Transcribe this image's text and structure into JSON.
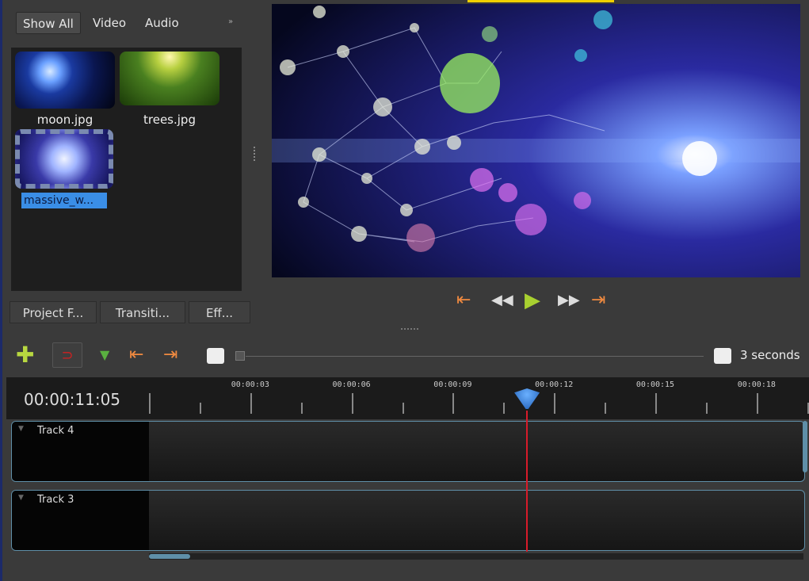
{
  "filter_tabs": [
    "Show All",
    "Video",
    "Audio"
  ],
  "files": [
    {
      "name": "moon.jpg"
    },
    {
      "name": "trees.jpg"
    },
    {
      "name": "massive_w..."
    }
  ],
  "bottom_tabs": [
    "Project F...",
    "Transiti...",
    "Eff..."
  ],
  "playback": {
    "jump_start": "jump-start-icon",
    "rewind": "rewind-icon",
    "play": "play-icon",
    "fast_forward": "fast-forward-icon",
    "jump_end": "jump-end-icon"
  },
  "timeline": {
    "current_time": "00:00:11:05",
    "zoom_label": "3 seconds",
    "ticks": [
      "00:00:03",
      "00:00:06",
      "00:00:09",
      "00:00:12",
      "00:00:15",
      "00:00:18"
    ],
    "playhead_seconds": 11.2
  },
  "tracks": [
    {
      "name": "Track 4"
    },
    {
      "name": "Track 3"
    }
  ],
  "colors": {
    "accent": "#3a8ee6",
    "playhead": "#d81b2a",
    "track_border": "#5f8fa8"
  }
}
